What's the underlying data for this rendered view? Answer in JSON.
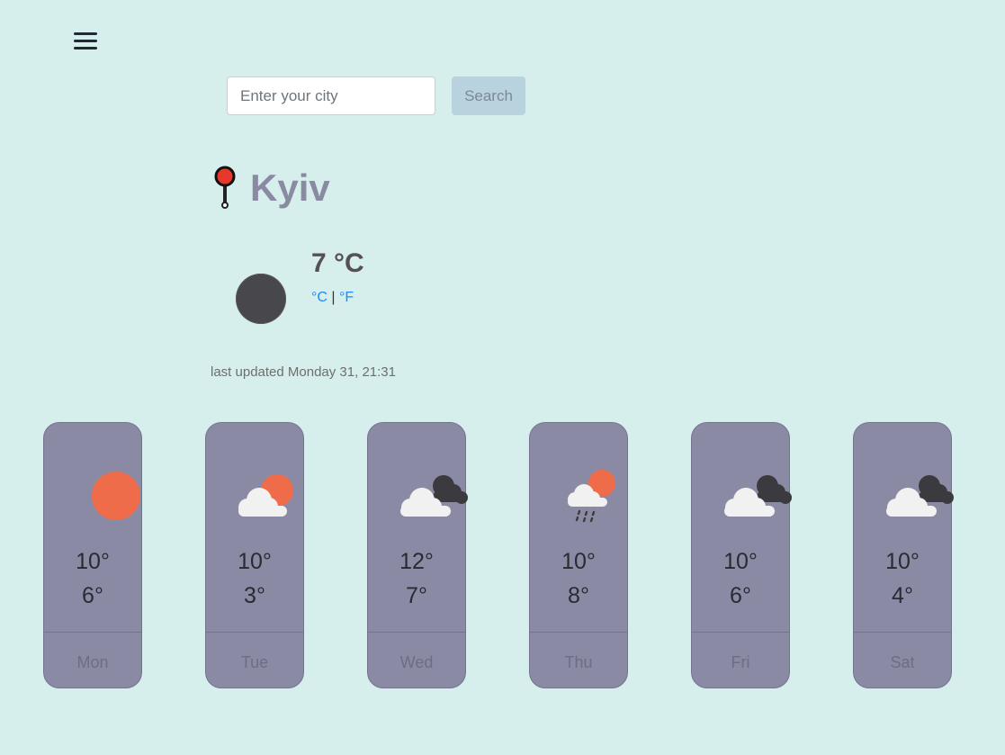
{
  "search": {
    "placeholder": "Enter your city",
    "button_label": "Search"
  },
  "location": {
    "city": "Kyiv",
    "icon": "map-pin-icon"
  },
  "current": {
    "icon": "night-moon-icon",
    "temperature": "7 °C",
    "unit_celsius": "°C",
    "unit_separator": "|",
    "unit_fahrenheit": "°F"
  },
  "last_updated": "last updated Monday 31, 21:31",
  "forecast": [
    {
      "day": "Mon",
      "hi": "10°",
      "lo": "6°",
      "icon": "sun-icon"
    },
    {
      "day": "Tue",
      "hi": "10°",
      "lo": "3°",
      "icon": "partly-sunny-icon"
    },
    {
      "day": "Wed",
      "hi": "12°",
      "lo": "7°",
      "icon": "cloudy-icon"
    },
    {
      "day": "Thu",
      "hi": "10°",
      "lo": "8°",
      "icon": "rain-sun-icon"
    },
    {
      "day": "Fri",
      "hi": "10°",
      "lo": "6°",
      "icon": "cloudy-icon"
    },
    {
      "day": "Sat",
      "hi": "10°",
      "lo": "4°",
      "icon": "cloudy-icon"
    }
  ],
  "colors": {
    "background": "#d6efec",
    "card": "#8a8aa4",
    "sun": "#ef6c4b",
    "cloud_white": "#f1f1f1",
    "cloud_dark": "#3b3b3f",
    "accent_link": "#1a8cff"
  }
}
